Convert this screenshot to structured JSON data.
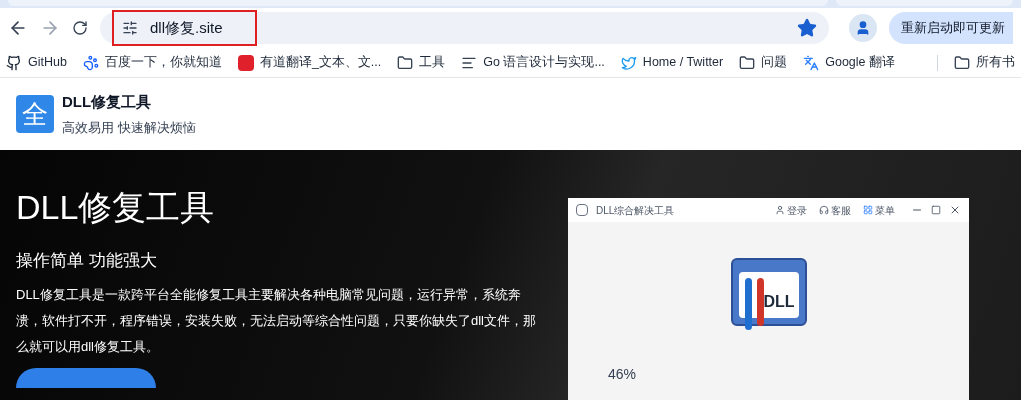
{
  "toolbar": {
    "url": "dll修复.site",
    "url_highlighted": true,
    "bookmarked": true,
    "update_button": "重新启动即可更新"
  },
  "bookmarks": [
    {
      "kind": "github",
      "label": "GitHub"
    },
    {
      "kind": "paw",
      "label": "百度一下，你就知道"
    },
    {
      "kind": "yd",
      "label": "有道翻译_文本、文..."
    },
    {
      "kind": "folder",
      "label": "工具"
    },
    {
      "kind": "lines",
      "label": "Go 语言设计与实现..."
    },
    {
      "kind": "bird",
      "label": "Home / Twitter"
    },
    {
      "kind": "folder",
      "label": "问题"
    },
    {
      "kind": "translate",
      "label": "Google 翻译"
    }
  ],
  "bookmarks_end": {
    "kind": "folder",
    "label": "所有书"
  },
  "site_header": {
    "logo_char": "全",
    "title": "DLL修复工具",
    "subtitle": "高效易用 快速解决烦恼"
  },
  "hero": {
    "title": "DLL修复工具",
    "subtitle": "操作简单 功能强大",
    "description": "DLL修复工具是一款跨平台全能修复工具主要解决各种电脑常见问题，运行异常，系统奔溃，软件打不开，程序错误，安装失败，无法启动等综合性问题，只要你缺失了dll文件，那么就可以用dll修复工具。"
  },
  "app_window": {
    "title": "DLL综合解决工具",
    "actions": [
      {
        "kind": "user",
        "label": "登录"
      },
      {
        "kind": "headset",
        "label": "客服"
      },
      {
        "kind": "grid",
        "label": "菜单"
      }
    ],
    "icon_text": "DLL",
    "progress_text": "46%"
  }
}
